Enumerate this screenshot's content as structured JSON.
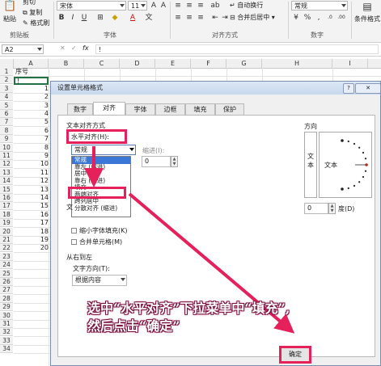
{
  "ribbon": {
    "cut": "剪切",
    "paste": "粘贴",
    "copy": "复制",
    "format_painter": "格式刷",
    "clipboard_group": "剪贴板",
    "font_name": "宋体",
    "font_size": "11",
    "bold": "B",
    "italic": "I",
    "underline": "U",
    "font_group": "字体",
    "wrap_text": "自动换行",
    "merge_center": "合并后居中",
    "alignment_group": "对齐方式",
    "number_format": "常规",
    "number_group": "数字",
    "conditional_format": "条件格式"
  },
  "formula_bar": {
    "name_box": "A2",
    "cancel": "✕",
    "enter": "✓",
    "fx": "fx",
    "content": "!"
  },
  "sheet": {
    "columns": [
      "A",
      "B",
      "C",
      "D",
      "E",
      "F",
      "G",
      "H",
      "I"
    ],
    "rows": [
      "1",
      "2",
      "3",
      "4",
      "5",
      "6",
      "7",
      "8",
      "9",
      "10",
      "11",
      "12",
      "13",
      "14",
      "15",
      "16",
      "17",
      "18",
      "19",
      "20",
      "21",
      "22",
      "23",
      "24",
      "25",
      "26",
      "27",
      "28",
      "29",
      "30",
      "31",
      "32",
      "33",
      "34"
    ],
    "a1": "序号",
    "a2": "!",
    "values": [
      "1",
      "2",
      "3",
      "4",
      "5",
      "6",
      "7",
      "8",
      "9",
      "10",
      "11",
      "12",
      "13",
      "14",
      "15",
      "16",
      "17",
      "18",
      "19",
      "20"
    ]
  },
  "dialog": {
    "title": "设置单元格格式",
    "help": "?",
    "close": "✕",
    "tabs": [
      "数字",
      "对齐",
      "字体",
      "边框",
      "填充",
      "保护"
    ],
    "text_alignment": "文本对齐方式",
    "horizontal": "水平对齐(H):",
    "horizontal_value": "常规",
    "indent": "缩进(I):",
    "indent_value": "0",
    "options": [
      "常规",
      "靠左 (缩进)",
      "居中",
      "靠右 (缩进)",
      "填充",
      "两端对齐",
      "跨列居中",
      "分散对齐 (缩进)"
    ],
    "text_control_partial": "文",
    "shrink_to_fit": "缩小字体填充(K)",
    "merge_cells": "合并单元格(M)",
    "rtl": "从右到左",
    "text_direction": "文字方向(T):",
    "text_direction_value": "根据内容",
    "orientation": "方向",
    "vertical_text": "文本",
    "horizontal_text": "文本",
    "degree_value": "0",
    "degree_unit": "度(D)",
    "ok": "确定"
  },
  "annotation": {
    "line1": "选中“水平对齐”下拉菜单中“填充”,",
    "line2": "然后点击“确定”",
    "color": "#e6205a"
  }
}
